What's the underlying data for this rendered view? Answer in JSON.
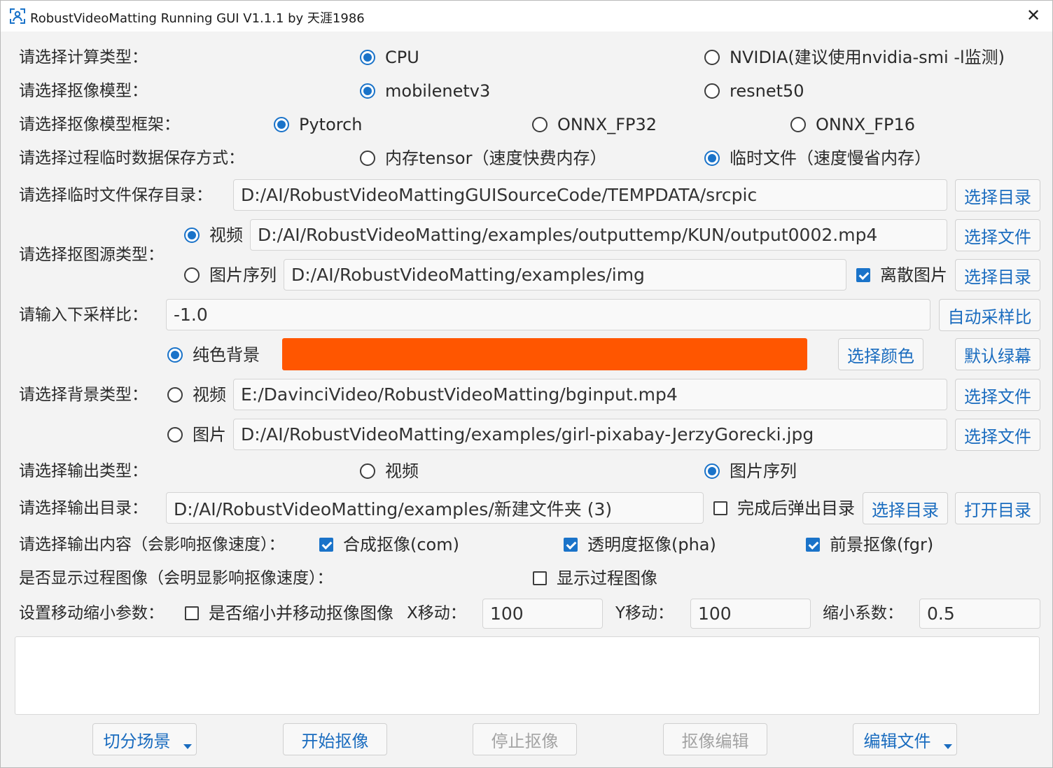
{
  "window": {
    "title": "RobustVideoMatting Running GUI V1.1.1 by 天涯1986",
    "close_glyph": "✕"
  },
  "compute_type": {
    "label": "请选择计算类型：",
    "options": [
      "CPU",
      "NVIDIA(建议使用nvidia-smi -l监测)"
    ],
    "selected": "CPU"
  },
  "matting_model": {
    "label": "请选择抠像模型：",
    "options": [
      "mobilenetv3",
      "resnet50"
    ],
    "selected": "mobilenetv3"
  },
  "model_framework": {
    "label": "请选择抠像模型框架：",
    "options": [
      "Pytorch",
      "ONNX_FP32",
      "ONNX_FP16"
    ],
    "selected": "Pytorch"
  },
  "temp_storage": {
    "label": "请选择过程临时数据保存方式：",
    "options": [
      "内存tensor（速度快费内存）",
      "临时文件（速度慢省内存）"
    ],
    "selected": "临时文件（速度慢省内存）"
  },
  "temp_dir": {
    "label": "请选择临时文件保存目录：",
    "value": "D:/AI/RobustVideoMattingGUISourceCode/TEMPDATA/srcpic",
    "button": "选择目录"
  },
  "source_type": {
    "label": "请选择抠图源类型：",
    "video_label": "视频",
    "video_path": "D:/AI/RobustVideoMatting/examples/outputtemp/KUN/output0002.mp4",
    "video_button": "选择文件",
    "seq_label": "图片序列",
    "seq_path": "D:/AI/RobustVideoMatting/examples/img",
    "discrete_label": "离散图片",
    "discrete_checked": true,
    "seq_button": "选择目录",
    "selected": "视频"
  },
  "downsample": {
    "label": "请输入下采样比：",
    "value": "-1.0",
    "button": "自动采样比"
  },
  "background": {
    "label": "请选择背景类型：",
    "solid_label": "纯色背景",
    "solid_color": "#ff5600",
    "pick_color_button": "选择颜色",
    "default_green_button": "默认绿幕",
    "video_label": "视频",
    "video_path": "E:/DavinciVideo/RobustVideoMatting/bginput.mp4",
    "video_button": "选择文件",
    "image_label": "图片",
    "image_path": "D:/AI/RobustVideoMatting/examples/girl-pixabay-JerzyGorecki.jpg",
    "image_button": "选择文件",
    "selected": "纯色背景"
  },
  "output_type": {
    "label": "请选择输出类型：",
    "options": [
      "视频",
      "图片序列"
    ],
    "selected": "图片序列"
  },
  "output_dir": {
    "label": "请选择输出目录：",
    "value": "D:/AI/RobustVideoMatting/examples/新建文件夹 (3)",
    "popup_label": "完成后弹出目录",
    "popup_checked": false,
    "select_button": "选择目录",
    "open_button": "打开目录"
  },
  "output_content": {
    "label": "请选择输出内容（会影响抠像速度）：",
    "items": [
      {
        "label": "合成抠像(com)",
        "checked": true
      },
      {
        "label": "透明度抠像(pha)",
        "checked": true
      },
      {
        "label": "前景抠像(fgr)",
        "checked": true
      }
    ]
  },
  "show_process": {
    "label": "是否显示过程图像（会明显影响抠像速度）：",
    "check_label": "显示过程图像",
    "checked": false
  },
  "move_scale": {
    "label": "设置移动缩小参数：",
    "check_label": "是否缩小并移动抠像图像",
    "checked": false,
    "x_label": "X移动：",
    "x_value": "100",
    "y_label": "Y移动：",
    "y_value": "100",
    "scale_label": "缩小系数：",
    "scale_value": "0.5"
  },
  "log": {
    "text": ""
  },
  "bottom_buttons": {
    "split_scene": "切分场景",
    "start": "开始抠像",
    "stop": "停止抠像",
    "edit_matting": "抠像编辑",
    "edit_file": "编辑文件"
  },
  "colors": {
    "accent": "#1a73c9",
    "button_text": "#1a6cbf",
    "disabled_text": "#a3a3a3"
  }
}
